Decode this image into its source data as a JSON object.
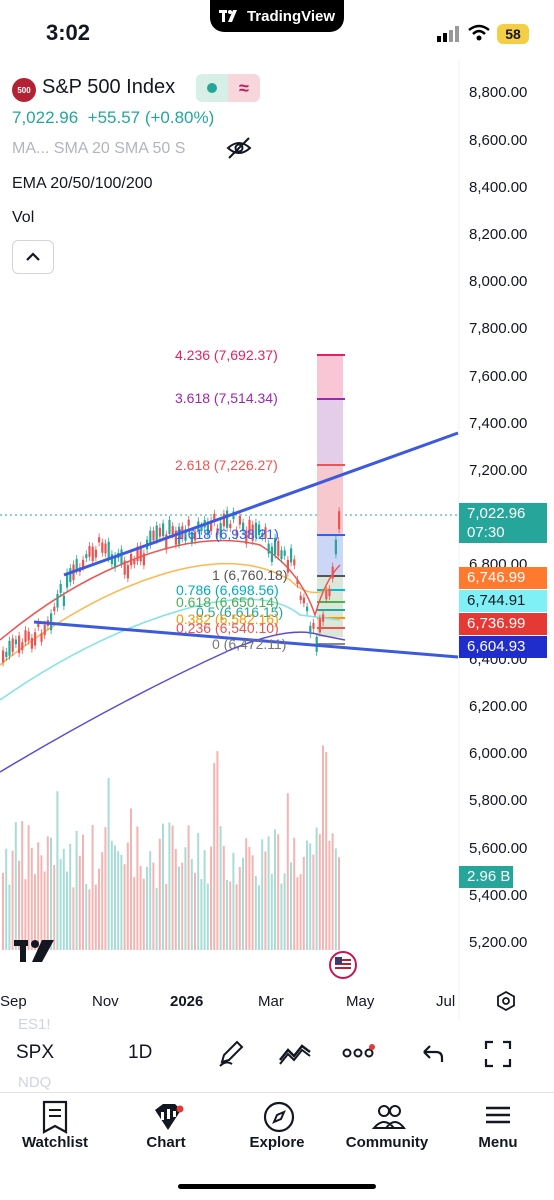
{
  "status_bar": {
    "time": "3:02",
    "app_pill": "TradingView",
    "battery": "58"
  },
  "header": {
    "logo_text": "500",
    "symbol_name": "S&P 500 Index",
    "price": "7,022.96",
    "change": "+55.57 (+0.80%)",
    "indicators_line": "MA... SMA 20 SMA 50 S",
    "ema_line": "EMA 20/50/100/200",
    "vol_line": "Vol"
  },
  "price_axis": [
    "8,800.00",
    "8,600.00",
    "8,400.00",
    "8,200.00",
    "8,000.00",
    "7,800.00",
    "7,600.00",
    "7,400.00",
    "7,200.00",
    "6,800.00",
    "6,400.00",
    "6,200.00",
    "6,000.00",
    "5,800.00",
    "5,600.00",
    "5,400.00",
    "5,200.00"
  ],
  "price_tags": {
    "last_price": "7,022.96",
    "countdown": "07:30",
    "tag1": "6,746.99",
    "tag2": "6,744.91",
    "tag3": "6,736.99",
    "tag4": "6,604.93",
    "volume": "2.96 B"
  },
  "fib_levels": [
    "4.236 (7,692.37)",
    "3.618 (7,514.34)",
    "2.618 (7,226.27)",
    "1.618 (6,938.21)",
    "1 (6,760.18)",
    "0.786 (6,698.56)",
    "0.618 (6,650.14)",
    "0.5 (6,616.15)",
    "0.382 (6,582.16)",
    "0.236 (6,540.10)",
    "0 (6,472.11)"
  ],
  "time_axis": [
    "Sep",
    "Nov",
    "2026",
    "Mar",
    "May",
    "Jul"
  ],
  "faded_symbols": [
    "ES1!",
    "NDQ"
  ],
  "toolbar": {
    "symbol": "SPX",
    "interval": "1D"
  },
  "bottom_nav": [
    "Watchlist",
    "Chart",
    "Explore",
    "Community",
    "Menu"
  ],
  "colors": {
    "up": "#26a69a",
    "down": "#ef5350",
    "trend": "#2962ff",
    "fib_ext": "#e91e63",
    "fib_mid": "#9c27b0"
  }
}
